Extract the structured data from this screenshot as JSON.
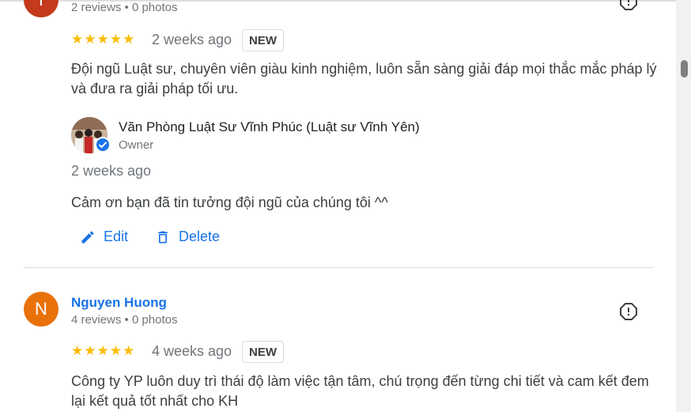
{
  "reviews": [
    {
      "avatar_letter": "T",
      "avatar_color": "#c5391c",
      "meta": "2 reviews • 0 photos",
      "rating_stars": "★★★★★",
      "rating": 5,
      "time": "2 weeks ago",
      "badge": "NEW",
      "text_line1": "Đội ngũ Luật sư, chuyên viên giàu kinh nghiệm, luôn sẵn sàng giải đáp mọi thắc mắc pháp lý",
      "text_line2": "và đưa ra giải pháp tối ưu.",
      "owner_reply": {
        "name": "Văn Phòng Luật Sư Vĩnh Phúc (Luật sư Vĩnh Yên)",
        "role": "Owner",
        "time": "2 weeks ago",
        "text": "Cảm ơn bạn đã tin tưởng đội ngũ của chúng tôi ^^"
      },
      "actions": {
        "edit": "Edit",
        "delete": "Delete"
      }
    },
    {
      "avatar_letter": "N",
      "avatar_color": "#e8710a",
      "name": "Nguyen Huong",
      "meta": "4 reviews • 0 photos",
      "rating_stars": "★★★★★",
      "rating": 5,
      "time": "4 weeks ago",
      "badge": "NEW",
      "text_line1": "Công ty YP luôn duy trì thái độ làm việc tận tâm, chú trọng đến từng chi tiết và cam kết đem",
      "text_line2": "lại kết quả tốt nhất cho KH"
    }
  ],
  "icons": {
    "flag": "report-flag-icon",
    "edit": "pencil-icon",
    "delete": "trash-icon",
    "verified": "verified-check-icon"
  }
}
